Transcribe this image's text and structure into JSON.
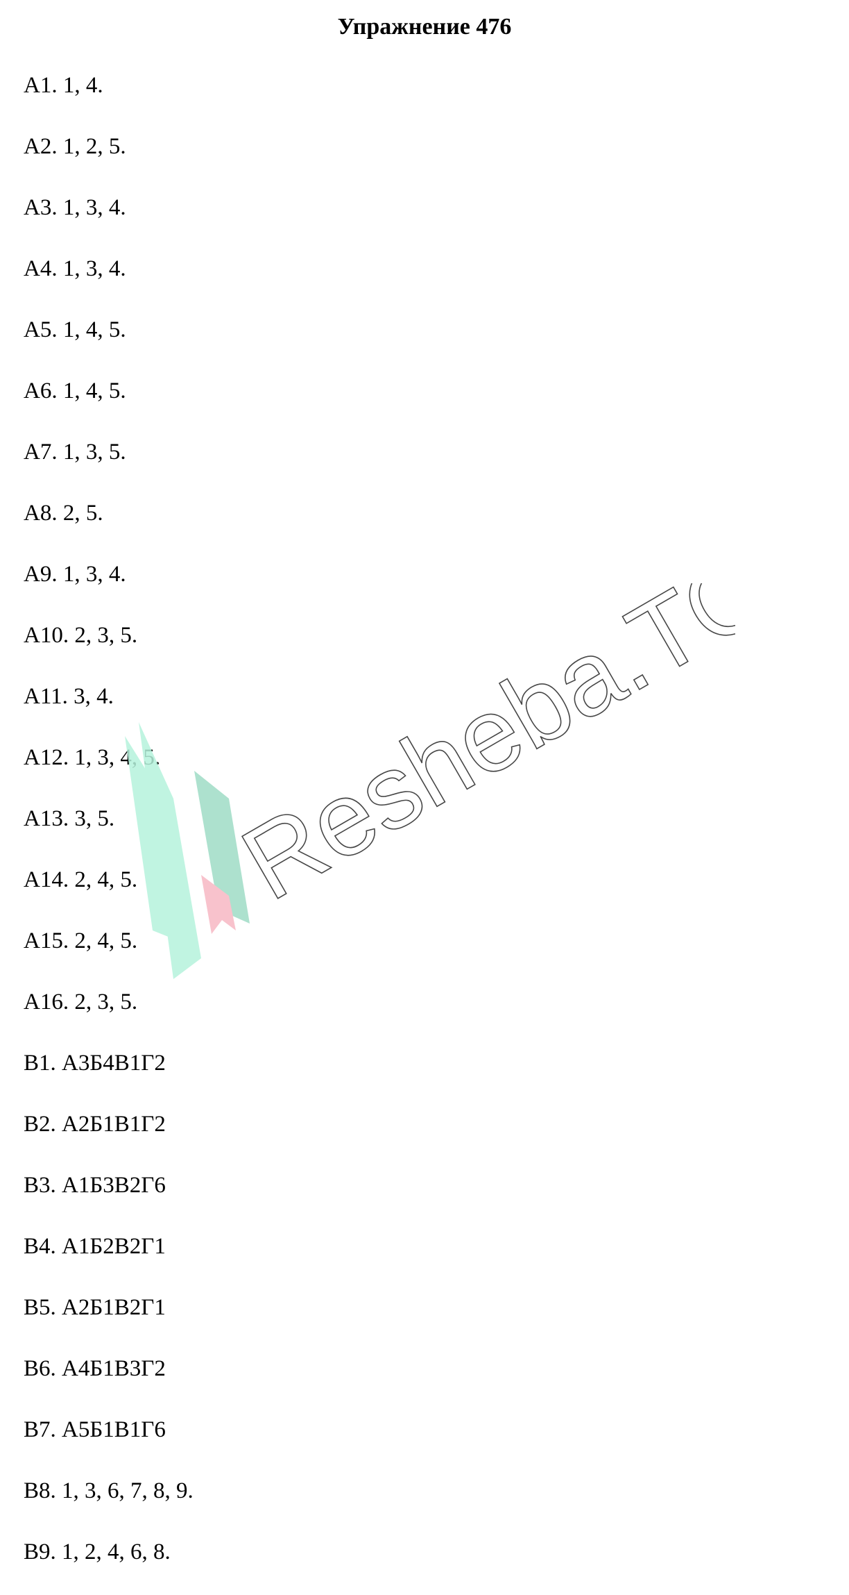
{
  "document": {
    "title": "Упражнение 476",
    "answers": [
      "А1. 1, 4.",
      "А2. 1, 2, 5.",
      "А3. 1, 3, 4.",
      "А4. 1, 3, 4.",
      "А5. 1, 4, 5.",
      "А6. 1, 4, 5.",
      "А7. 1, 3, 5.",
      "А8. 2, 5.",
      "А9. 1, 3, 4.",
      "А10. 2, 3, 5.",
      "А11. 3, 4.",
      "А12. 1, 3, 4, 5.",
      "А13. 3, 5.",
      "А14. 2, 4, 5.",
      "А15. 2, 4, 5.",
      "А16. 2, 3, 5.",
      "В1. А3Б4В1Г2",
      "В2. А2Б1В1Г2",
      "В3. А1Б3В2Г6",
      "В4. А1Б2В2Г1",
      "В5. А2Б1В2Г1",
      "В6. А4Б1В3Г2",
      "В7. А5Б1В1Г6",
      "В8. 1, 3, 6, 7, 8, 9.",
      "В9. 1, 2, 4, 6, 8."
    ]
  },
  "watermark": {
    "text": "Resheba.TOP",
    "colors": {
      "logo_green": "#b6f3dc",
      "logo_green_dark": "#9fdcc6",
      "logo_pink": "#f7b8c4",
      "text_stroke": "#333333"
    }
  }
}
